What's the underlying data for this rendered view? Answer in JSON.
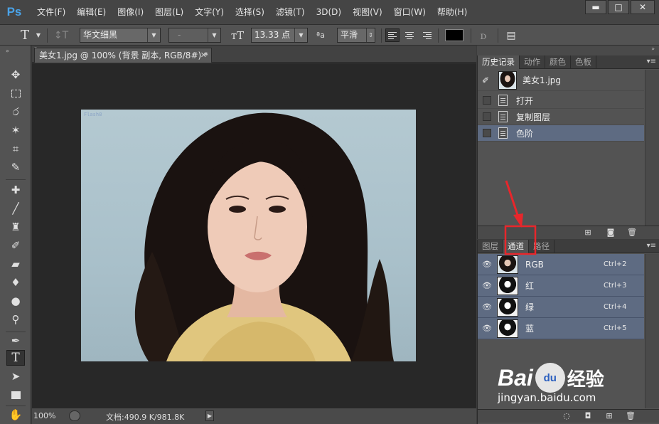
{
  "app": {
    "logo": "Ps"
  },
  "menu": [
    "文件(F)",
    "编辑(E)",
    "图像(I)",
    "图层(L)",
    "文字(Y)",
    "选择(S)",
    "滤镜(T)",
    "3D(D)",
    "视图(V)",
    "窗口(W)",
    "帮助(H)"
  ],
  "window_controls": {
    "minimize": "▬",
    "maximize": "□",
    "close": "✕"
  },
  "options": {
    "tool_glyph": "T",
    "font_family": "华文细黑",
    "font_style": "-",
    "font_size": "13.33 点",
    "aa_label": "ªa",
    "antialias": "平滑"
  },
  "document": {
    "tab_title": "美女1.jpg @ 100% (背景 副本, RGB/8#) *",
    "tab_close": "✕",
    "image_watermark": "Flash8",
    "zoom": "100%",
    "doc_info": "文档:490.9 K/981.8K"
  },
  "history_panel": {
    "tabs": [
      "历史记录",
      "动作",
      "颜色",
      "色板"
    ],
    "snapshot": "美女1.jpg",
    "states": [
      {
        "label": "打开",
        "selected": false
      },
      {
        "label": "复制图层",
        "selected": false
      },
      {
        "label": "色阶",
        "selected": true
      }
    ]
  },
  "channels_panel": {
    "tabs": [
      "图层",
      "通道",
      "路径"
    ],
    "channels": [
      {
        "name": "RGB",
        "shortcut": "Ctrl+2"
      },
      {
        "name": "红",
        "shortcut": "Ctrl+3"
      },
      {
        "name": "绿",
        "shortcut": "Ctrl+4"
      },
      {
        "name": "蓝",
        "shortcut": "Ctrl+5"
      }
    ]
  },
  "watermark": {
    "brand": "Bai",
    "paw": "du",
    "cn": "经验",
    "url": "jingyan.baidu.com"
  },
  "colors": {
    "accent_red": "#e8262b",
    "selection": "#5e6b82",
    "ps_blue": "#4aa3e8"
  }
}
